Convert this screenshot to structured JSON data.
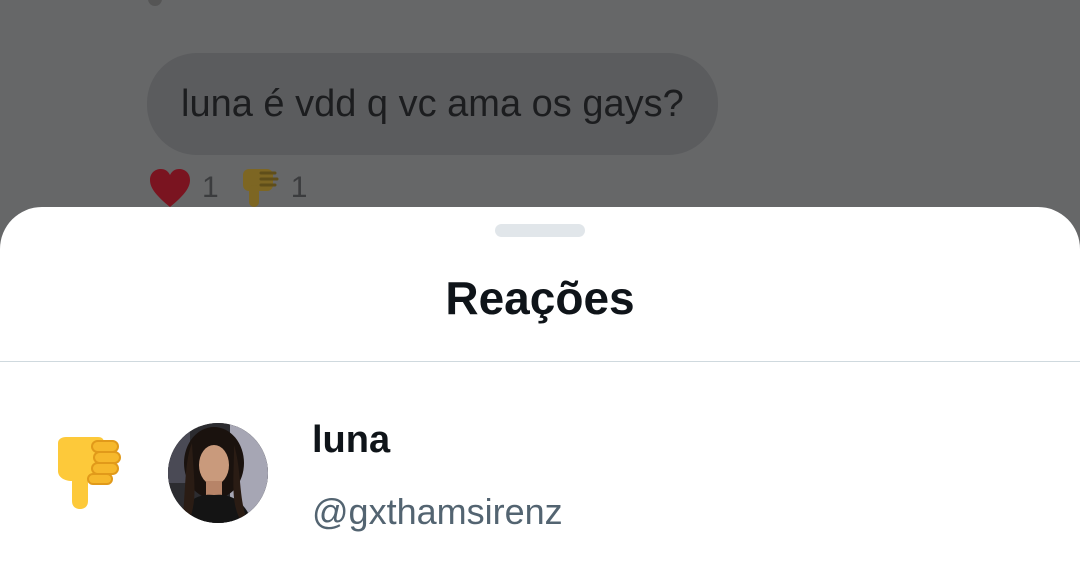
{
  "conversation": {
    "message_text": "luna é vdd q vc ama os gays?",
    "reactions": [
      {
        "icon": "heart-icon",
        "count": "1"
      },
      {
        "icon": "thumbs-down-icon",
        "count": "1"
      }
    ]
  },
  "sheet": {
    "title": "Reações",
    "reactors": [
      {
        "reaction_icon": "thumbs-down-icon",
        "name": "luna",
        "handle": "@gxthamsirenz"
      }
    ]
  },
  "colors": {
    "overlay": "#666768",
    "heart": "#9a1a2a",
    "thumbs_down": "#fdc93a",
    "secondary_text": "#536471"
  }
}
